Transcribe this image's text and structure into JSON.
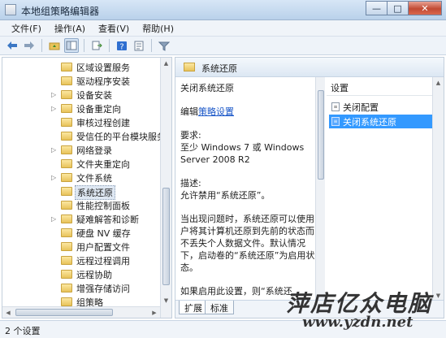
{
  "window": {
    "title": "本地组策略编辑器",
    "buttons": {
      "minimize": "—",
      "maximize": "□",
      "close": "✕"
    }
  },
  "menu": [
    "文件(F)",
    "操作(A)",
    "查看(V)",
    "帮助(H)"
  ],
  "toolbar": {
    "icons": [
      "back-arrow-icon",
      "forward-arrow-icon",
      "up-folder-icon",
      "show-hide-tree-icon",
      "export-list-icon",
      "help-icon",
      "properties-icon",
      "filter-icon"
    ]
  },
  "tree": {
    "items": [
      {
        "label": "区域设置服务",
        "expandable": false
      },
      {
        "label": "驱动程序安装",
        "expandable": false
      },
      {
        "label": "设备安装",
        "expandable": true
      },
      {
        "label": "设备重定向",
        "expandable": true
      },
      {
        "label": "审核过程创建",
        "expandable": false
      },
      {
        "label": "受信任的平台模块服务",
        "expandable": false
      },
      {
        "label": "网络登录",
        "expandable": true
      },
      {
        "label": "文件夹重定向",
        "expandable": false
      },
      {
        "label": "文件系统",
        "expandable": true
      },
      {
        "label": "系统还原",
        "expandable": false,
        "selected": true
      },
      {
        "label": "性能控制面板",
        "expandable": false
      },
      {
        "label": "疑难解答和诊断",
        "expandable": true
      },
      {
        "label": "硬盘 NV 缓存",
        "expandable": false
      },
      {
        "label": "用户配置文件",
        "expandable": false
      },
      {
        "label": "远程过程调用",
        "expandable": false
      },
      {
        "label": "远程协助",
        "expandable": false
      },
      {
        "label": "增强存储访问",
        "expandable": false
      },
      {
        "label": "组策略",
        "expandable": false
      }
    ]
  },
  "right": {
    "header_title": "系统还原",
    "description": {
      "title": "关闭系统还原",
      "edit_prefix": "编辑",
      "edit_link": "策略设置",
      "requirements_label": "要求:",
      "requirements_text": "至少 Windows 7 或 Windows Server 2008 R2",
      "desc_label": "描述:",
      "desc_text": "允许禁用“系统还原”。",
      "body_text": "当出现问题时，系统还原可以使用户将其计算机还原到先前的状态而不丢失个人数据文件。默认情况下，启动卷的“系统还原”为启用状态。",
      "body_text2": "如果启用此设置，则“系统还"
    },
    "list": {
      "header": "设置",
      "items": [
        {
          "label": "关闭配置",
          "selected": false
        },
        {
          "label": "关闭系统还原",
          "selected": true
        }
      ]
    },
    "tabs": [
      "扩展",
      "标准"
    ]
  },
  "status": {
    "text": "2 个设置"
  },
  "watermark": {
    "cn": "萍店亿众电脑",
    "url": "www.yzdn.net"
  }
}
